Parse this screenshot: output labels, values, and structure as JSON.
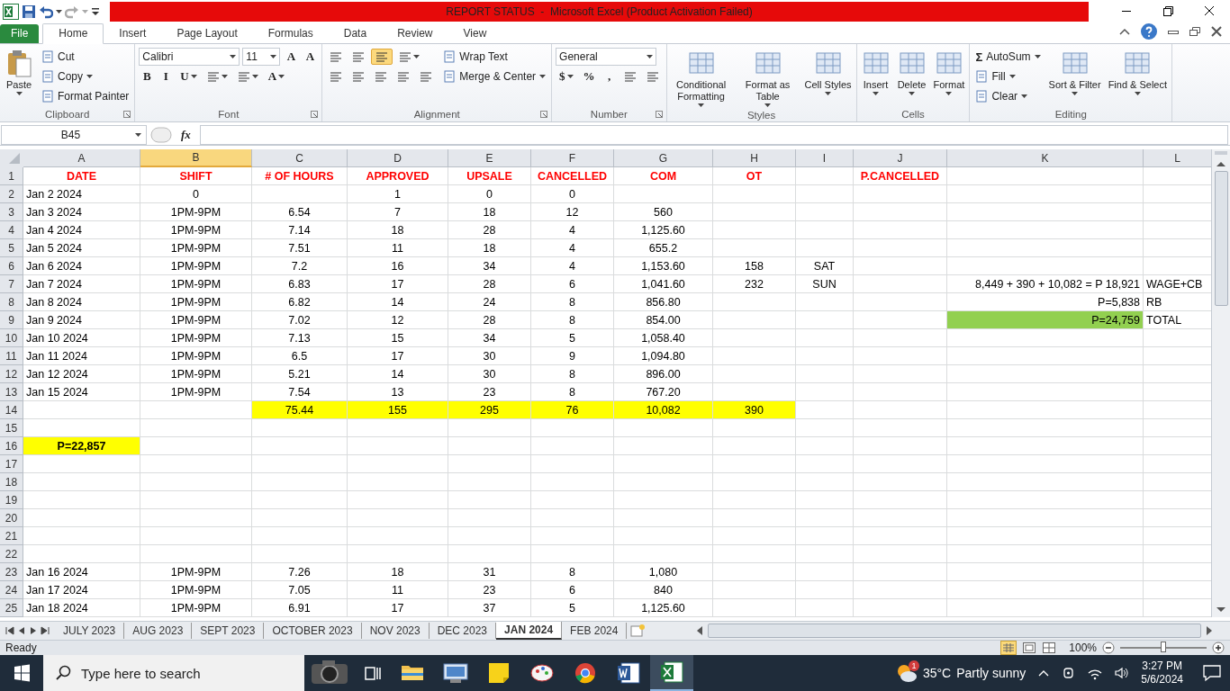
{
  "window": {
    "title": "REPORT STATUS  -  Microsoft Excel (Product Activation Failed)"
  },
  "tabs": [
    {
      "label": "File",
      "kind": "file",
      "selected": false
    },
    {
      "label": "Home",
      "kind": "tab",
      "selected": true
    },
    {
      "label": "Insert",
      "kind": "tab",
      "selected": false
    },
    {
      "label": "Page Layout",
      "kind": "tab",
      "selected": false
    },
    {
      "label": "Formulas",
      "kind": "tab",
      "selected": false
    },
    {
      "label": "Data",
      "kind": "tab",
      "selected": false
    },
    {
      "label": "Review",
      "kind": "tab",
      "selected": false
    },
    {
      "label": "View",
      "kind": "tab",
      "selected": false
    }
  ],
  "ribbon": [
    {
      "label": "Clipboard",
      "launcher": true,
      "blocks": [
        {
          "kind": "large",
          "label": "Paste",
          "caret": true
        },
        {
          "kind": "stack",
          "lines": [
            {
              "items": [
                {
                  "kind": "button",
                  "label": "Cut"
                }
              ]
            },
            {
              "items": [
                {
                  "kind": "button",
                  "label": "Copy",
                  "caret": true
                }
              ]
            },
            {
              "items": [
                {
                  "kind": "button",
                  "label": "Format Painter"
                }
              ]
            }
          ]
        }
      ]
    },
    {
      "label": "Font",
      "launcher": true,
      "blocks": [
        {
          "kind": "stack",
          "lines": [
            {
              "items": [
                {
                  "kind": "field",
                  "value": "Calibri",
                  "wide": true
                },
                {
                  "kind": "field",
                  "value": "11"
                },
                {
                  "kind": "glyph",
                  "text": "A"
                },
                {
                  "kind": "glyph",
                  "text": "A"
                }
              ]
            },
            {
              "items": [
                {
                  "kind": "glyph",
                  "text": "B"
                },
                {
                  "kind": "glyph",
                  "text": "I"
                },
                {
                  "kind": "glyph",
                  "text": "U",
                  "caret": true
                },
                {
                  "kind": "icon",
                  "caret": true
                },
                {
                  "kind": "icon",
                  "caret": true
                },
                {
                  "kind": "glyph",
                  "text": "A",
                  "caret": true
                }
              ]
            }
          ]
        }
      ]
    },
    {
      "label": "Alignment",
      "launcher": true,
      "blocks": [
        {
          "kind": "stack",
          "lines": [
            {
              "items": [
                {
                  "kind": "icon",
                  "selected": false
                },
                {
                  "kind": "icon",
                  "selected": false
                },
                {
                  "kind": "icon",
                  "selected": true
                },
                {
                  "kind": "icon",
                  "selected": false,
                  "caret": true
                }
              ]
            },
            {
              "items": [
                {
                  "kind": "icon",
                  "selected": false
                },
                {
                  "kind": "icon",
                  "selected": false
                },
                {
                  "kind": "icon",
                  "selected": false
                },
                {
                  "kind": "icon",
                  "selected": false
                },
                {
                  "kind": "icon",
                  "selected": false
                }
              ]
            }
          ]
        },
        {
          "kind": "stack",
          "lines": [
            {
              "items": [
                {
                  "kind": "button",
                  "label": "Wrap Text"
                }
              ]
            },
            {
              "items": [
                {
                  "kind": "button",
                  "label": "Merge & Center",
                  "caret": true
                }
              ]
            }
          ]
        }
      ]
    },
    {
      "label": "Number",
      "launcher": true,
      "blocks": [
        {
          "kind": "stack",
          "lines": [
            {
              "items": [
                {
                  "kind": "field",
                  "value": "General",
                  "wide": true
                }
              ]
            },
            {
              "items": [
                {
                  "kind": "glyph",
                  "text": "$",
                  "caret": true
                },
                {
                  "kind": "glyph",
                  "text": "%"
                },
                {
                  "kind": "glyph",
                  "text": ","
                },
                {
                  "kind": "icon"
                },
                {
                  "kind": "icon"
                }
              ]
            }
          ]
        }
      ]
    },
    {
      "label": "Styles",
      "blocks": [
        {
          "kind": "large",
          "label": "Conditional Formatting",
          "caret": true
        },
        {
          "kind": "large",
          "label": "Format as Table",
          "caret": true
        },
        {
          "kind": "large",
          "label": "Cell Styles",
          "caret": true
        }
      ]
    },
    {
      "label": "Cells",
      "blocks": [
        {
          "kind": "large",
          "label": "Insert",
          "caret": true
        },
        {
          "kind": "large",
          "label": "Delete",
          "caret": true
        },
        {
          "kind": "large",
          "label": "Format",
          "caret": true
        }
      ]
    },
    {
      "label": "Editing",
      "blocks": [
        {
          "kind": "stack",
          "lines": [
            {
              "items": [
                {
                  "kind": "button",
                  "symbol": "Σ",
                  "label": "AutoSum",
                  "caret": true
                }
              ]
            },
            {
              "items": [
                {
                  "kind": "button",
                  "label": "Fill",
                  "caret": true
                }
              ]
            },
            {
              "items": [
                {
                  "kind": "button",
                  "label": "Clear",
                  "caret": true
                }
              ]
            }
          ]
        },
        {
          "kind": "large",
          "label": "Sort & Filter",
          "caret": true
        },
        {
          "kind": "large",
          "label": "Find & Select",
          "caret": true
        }
      ]
    }
  ],
  "formula_bar": {
    "name_box": "B45",
    "fx_symbol": "fx"
  },
  "columns": [
    {
      "letter": "A",
      "selected": false
    },
    {
      "letter": "B",
      "selected": true
    },
    {
      "letter": "C",
      "selected": false
    },
    {
      "letter": "D",
      "selected": false
    },
    {
      "letter": "E",
      "selected": false
    },
    {
      "letter": "F",
      "selected": false
    },
    {
      "letter": "G",
      "selected": false
    },
    {
      "letter": "H",
      "selected": false
    },
    {
      "letter": "I",
      "selected": false
    },
    {
      "letter": "J",
      "selected": false
    },
    {
      "letter": "K",
      "selected": false
    },
    {
      "letter": "L",
      "selected": false
    }
  ],
  "rows": [
    {
      "row": "1",
      "kind": "header",
      "cells": {
        "A": "DATE",
        "B": "SHIFT",
        "C": "# OF HOURS",
        "D": "APPROVED",
        "E": "UPSALE",
        "F": "CANCELLED",
        "G": "COM",
        "H": "OT",
        "J": "P.CANCELLED"
      }
    },
    {
      "row": "2",
      "cells": {
        "A": "Jan 2 2024",
        "B": "0",
        "D": "1",
        "E": "0",
        "F": "0"
      }
    },
    {
      "row": "3",
      "cells": {
        "A": "Jan 3 2024",
        "B": "1PM-9PM",
        "C": "6.54",
        "D": "7",
        "E": "18",
        "F": "12",
        "G": "560"
      }
    },
    {
      "row": "4",
      "cells": {
        "A": "Jan 4 2024",
        "B": "1PM-9PM",
        "C": "7.14",
        "D": "18",
        "E": "28",
        "F": "4",
        "G": "1,125.60"
      }
    },
    {
      "row": "5",
      "cells": {
        "A": "Jan 5 2024",
        "B": "1PM-9PM",
        "C": "7.51",
        "D": "11",
        "E": "18",
        "F": "4",
        "G": "655.2"
      }
    },
    {
      "row": "6",
      "cells": {
        "A": "Jan 6 2024",
        "B": "1PM-9PM",
        "C": "7.2",
        "D": "16",
        "E": "34",
        "F": "4",
        "G": "1,153.60",
        "H": "158",
        "I": "SAT"
      }
    },
    {
      "row": "7",
      "cells": {
        "A": "Jan 7 2024",
        "B": "1PM-9PM",
        "C": "6.83",
        "D": "17",
        "E": "28",
        "F": "6",
        "G": "1,041.60",
        "H": "232",
        "I": "SUN",
        "K": "8,449 + 390 + 10,082 = P 18,921",
        "L": "WAGE+CB"
      }
    },
    {
      "row": "8",
      "cells": {
        "A": "Jan 8 2024",
        "B": "1PM-9PM",
        "C": "6.82",
        "D": "14",
        "E": "24",
        "F": "8",
        "G": "856.80",
        "K": "P=5,838",
        "L": "RB"
      }
    },
    {
      "row": "9",
      "cells": {
        "A": "Jan 9 2024",
        "B": "1PM-9PM",
        "C": "7.02",
        "D": "12",
        "E": "28",
        "F": "8",
        "G": "854.00",
        "K": {
          "v": "P=24,759",
          "color": "#92d050"
        },
        "L": "TOTAL"
      }
    },
    {
      "row": "10",
      "cells": {
        "A": "Jan 10 2024",
        "B": "1PM-9PM",
        "C": "7.13",
        "D": "15",
        "E": "34",
        "F": "5",
        "G": "1,058.40"
      }
    },
    {
      "row": "11",
      "cells": {
        "A": "Jan 11 2024",
        "B": "1PM-9PM",
        "C": "6.5",
        "D": "17",
        "E": "30",
        "F": "9",
        "G": "1,094.80"
      }
    },
    {
      "row": "12",
      "cells": {
        "A": "Jan 12 2024",
        "B": "1PM-9PM",
        "C": "5.21",
        "D": "14",
        "E": "30",
        "F": "8",
        "G": "896.00"
      }
    },
    {
      "row": "13",
      "cells": {
        "A": "Jan 15 2024",
        "B": "1PM-9PM",
        "C": "7.54",
        "D": "13",
        "E": "23",
        "F": "8",
        "G": "767.20"
      }
    },
    {
      "row": "14",
      "cells": {
        "C": {
          "v": "75.44",
          "color": "#ffff00"
        },
        "D": {
          "v": "155",
          "color": "#ffff00"
        },
        "E": {
          "v": "295",
          "color": "#ffff00"
        },
        "F": {
          "v": "76",
          "color": "#ffff00"
        },
        "G": {
          "v": "10,082",
          "color": "#ffff00"
        },
        "H": {
          "v": "390",
          "color": "#ffff00"
        }
      }
    },
    {
      "row": "15",
      "cells": {}
    },
    {
      "row": "16",
      "cells": {
        "A": {
          "v": "P=22,857",
          "color": "#ffff00",
          "bold": true
        }
      }
    },
    {
      "row": "17",
      "cells": {}
    },
    {
      "row": "18",
      "cells": {}
    },
    {
      "row": "19",
      "cells": {}
    },
    {
      "row": "20",
      "cells": {}
    },
    {
      "row": "21",
      "cells": {}
    },
    {
      "row": "22",
      "cells": {}
    },
    {
      "row": "23",
      "cells": {
        "A": "Jan 16 2024",
        "B": "1PM-9PM",
        "C": "7.26",
        "D": "18",
        "E": "31",
        "F": "8",
        "G": "1,080"
      }
    },
    {
      "row": "24",
      "cells": {
        "A": "Jan 17 2024",
        "B": "1PM-9PM",
        "C": "7.05",
        "D": "11",
        "E": "23",
        "F": "6",
        "G": "840"
      }
    },
    {
      "row": "25",
      "cells": {
        "A": "Jan 18 2024",
        "B": "1PM-9PM",
        "C": "6.91",
        "D": "17",
        "E": "37",
        "F": "5",
        "G": "1,125.60"
      }
    }
  ],
  "sheet_tabs": [
    {
      "label": "JULY 2023",
      "selected": false
    },
    {
      "label": "AUG 2023",
      "selected": false
    },
    {
      "label": "SEPT 2023",
      "selected": false
    },
    {
      "label": "OCTOBER 2023",
      "selected": false
    },
    {
      "label": "NOV 2023",
      "selected": false
    },
    {
      "label": "DEC 2023",
      "selected": false
    },
    {
      "label": "JAN 2024",
      "selected": true
    },
    {
      "label": "FEB 2024",
      "selected": false
    }
  ],
  "status_bar": {
    "status": "Ready",
    "zoom": "100%",
    "zoom_level": {
      "level": 0.5
    }
  },
  "taskbar": {
    "search_placeholder": "Type here to search",
    "apps": [
      {
        "kind": "camera",
        "active": false
      },
      {
        "kind": "taskview",
        "active": false
      },
      {
        "kind": "folder",
        "active": false
      },
      {
        "kind": "monitor",
        "active": false
      },
      {
        "kind": "note",
        "active": false
      },
      {
        "kind": "paint",
        "active": false
      },
      {
        "kind": "browser",
        "active": false
      },
      {
        "kind": "word",
        "active": false
      },
      {
        "kind": "excel",
        "active": true
      }
    ],
    "weather_badge": "1",
    "temperature": "35°C",
    "weather": "Partly sunny",
    "time": "3:27 PM",
    "date": "5/6/2024"
  }
}
